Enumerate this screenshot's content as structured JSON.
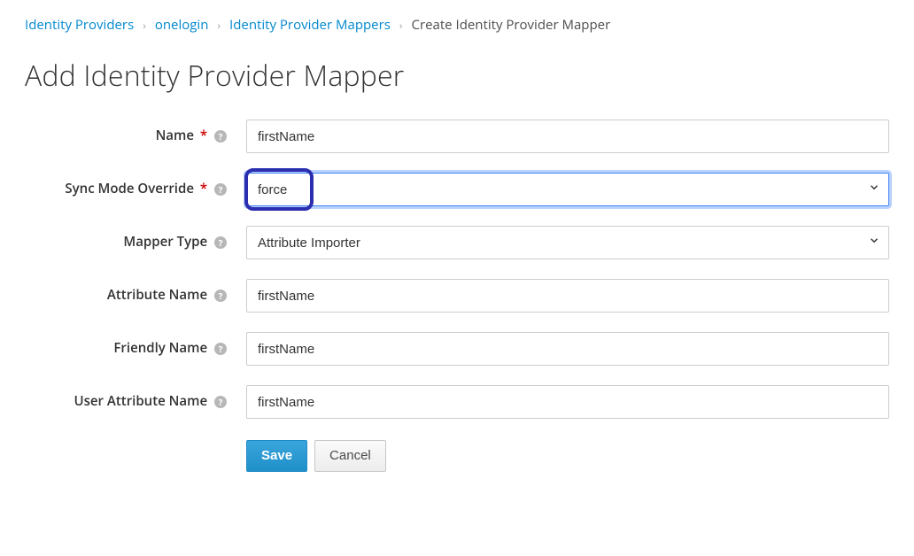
{
  "breadcrumb": {
    "items": [
      {
        "label": "Identity Providers",
        "link": true
      },
      {
        "label": "onelogin",
        "link": true
      },
      {
        "label": "Identity Provider Mappers",
        "link": true
      },
      {
        "label": "Create Identity Provider Mapper",
        "link": false
      }
    ]
  },
  "page": {
    "title": "Add Identity Provider Mapper"
  },
  "form": {
    "name": {
      "label": "Name",
      "value": "firstName",
      "required": true
    },
    "syncMode": {
      "label": "Sync Mode Override",
      "value": "force",
      "required": true
    },
    "mapperType": {
      "label": "Mapper Type",
      "value": "Attribute Importer",
      "required": false
    },
    "attributeName": {
      "label": "Attribute Name",
      "value": "firstName",
      "required": false
    },
    "friendlyName": {
      "label": "Friendly Name",
      "value": "firstName",
      "required": false
    },
    "userAttributeName": {
      "label": "User Attribute Name",
      "value": "firstName",
      "required": false
    }
  },
  "buttons": {
    "save": "Save",
    "cancel": "Cancel"
  },
  "glyphs": {
    "required": "*",
    "help": "?",
    "sep": "›"
  }
}
